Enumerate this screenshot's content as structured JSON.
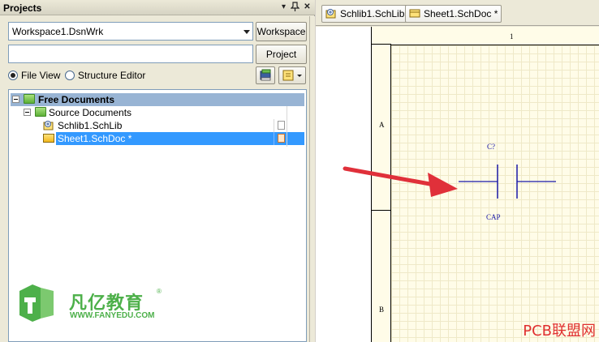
{
  "panel": {
    "title": "Projects",
    "workspace_value": "Workspace1.DsnWrk",
    "workspace_button": "Workspace",
    "search_value": "",
    "project_button": "Project",
    "view_options": [
      {
        "label": "File View",
        "checked": true
      },
      {
        "label": "Structure Editor",
        "checked": false
      }
    ]
  },
  "tree": {
    "root": "Free Documents",
    "group": "Source Documents",
    "items": [
      {
        "label": "Schlib1.SchLib",
        "selected": false
      },
      {
        "label": "Sheet1.SchDoc *",
        "selected": true
      }
    ]
  },
  "tabs": [
    {
      "label": "Schlib1.SchLib",
      "icon": "schlib-icon"
    },
    {
      "label": "Sheet1.SchDoc *",
      "icon": "schdoc-icon"
    }
  ],
  "schematic": {
    "column_label": "1",
    "row_labels": [
      "A",
      "B"
    ],
    "designator": "C?",
    "comment": "CAP"
  },
  "branding": {
    "logo_text": "凡亿教育",
    "logo_url_text": "WWW.FANYEDU.COM",
    "logo_registered": "®",
    "watermark": "PCB联盟网"
  },
  "colors": {
    "selection": "#3399ff",
    "tree_header": "#98b4d4",
    "component_blue": "#1a1aa8",
    "arrow_red": "#e0303a",
    "logo_green": "#4db04a"
  }
}
